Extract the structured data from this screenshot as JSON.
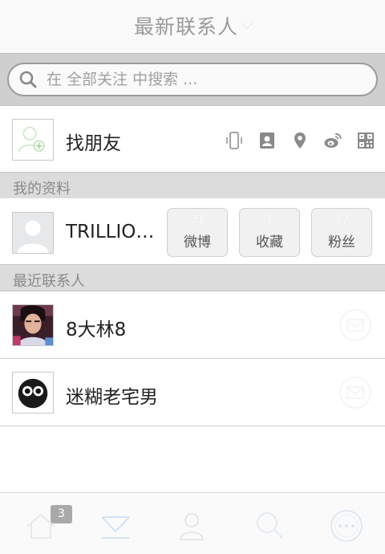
{
  "navbar": {
    "title": "最新联系人"
  },
  "search": {
    "placeholder": "在 全部关注 中搜索 ..."
  },
  "find_friends": {
    "label": "找朋友",
    "icons": [
      "shake-phone-icon",
      "contacts-card-icon",
      "location-pin-icon",
      "weibo-icon",
      "qr-code-icon"
    ]
  },
  "sections": {
    "my_profile": "我的资料",
    "recent_contacts": "最近联系人"
  },
  "profile": {
    "name": "TRILLIONSOFT",
    "stats": [
      {
        "count": "31",
        "label": "微博"
      },
      {
        "count": "1",
        "label": "收藏"
      },
      {
        "count": "47",
        "label": "粉丝"
      }
    ]
  },
  "contacts": [
    {
      "name": "8大林8"
    },
    {
      "name": "迷糊老宅男"
    }
  ],
  "tabbar": {
    "badge": "3",
    "tabs": [
      "home-icon",
      "inbox-icon",
      "contacts-icon",
      "search-icon",
      "more-icon"
    ]
  },
  "colors": {
    "section_bg": "#dcdcdc",
    "search_bg": "#cfcfcf",
    "accent_blue": "#dbe9f7"
  }
}
